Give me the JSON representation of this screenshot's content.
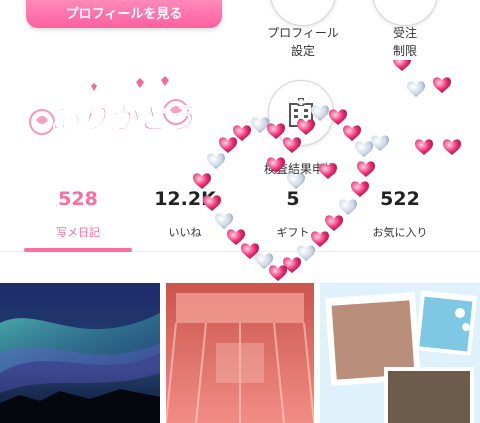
{
  "header": {
    "profile_button_label": "プロフィールを見る",
    "profile_settings_label": "プロフィール\n設定",
    "orders_label": "受注\n制限",
    "checkup_label": "検査結果申請"
  },
  "sticker": {
    "text": "ありがとう"
  },
  "stats": [
    {
      "value": "528",
      "label": "写メ日記",
      "active": true
    },
    {
      "value": "12.2K",
      "label": "いいね",
      "active": false
    },
    {
      "value": "5",
      "label": "ギフト",
      "active": false
    },
    {
      "value": "522",
      "label": "お気に入り",
      "active": false
    }
  ],
  "colors": {
    "accent": "#ff6fa1",
    "text": "#222222"
  },
  "photos": [
    {
      "name": "aurora-photo"
    },
    {
      "name": "pink-canopy-photo"
    },
    {
      "name": "collage-photo"
    }
  ]
}
